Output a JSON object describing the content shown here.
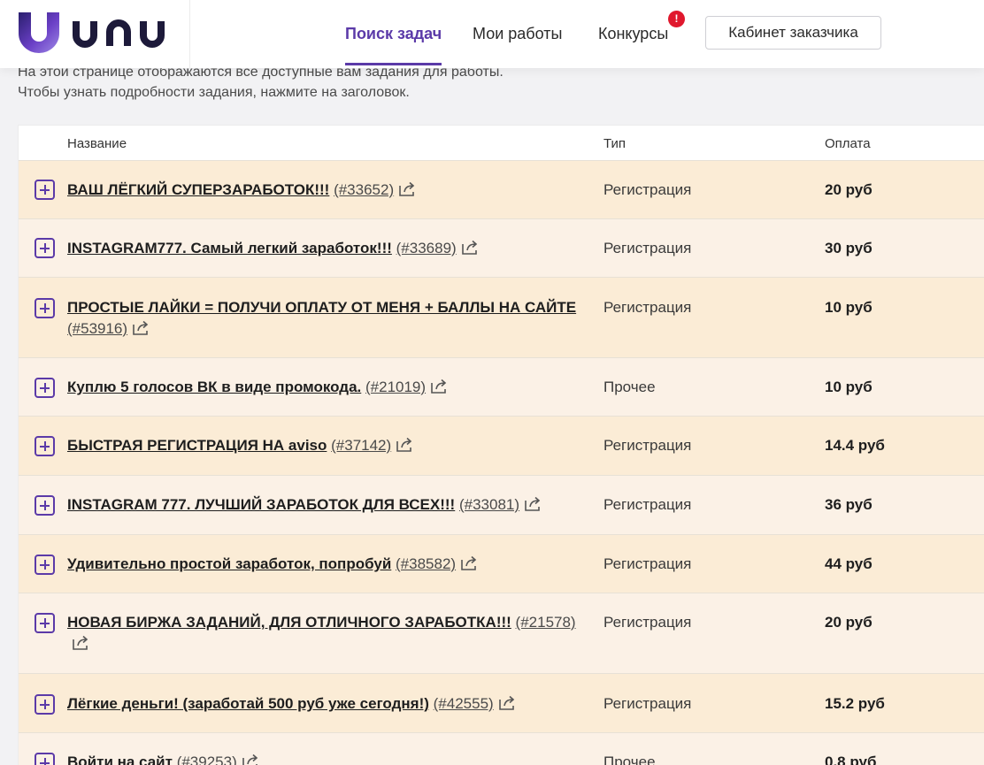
{
  "header": {
    "logo_text": "unu",
    "nav": [
      {
        "label": "Поиск задач"
      },
      {
        "label": "Мои работы"
      },
      {
        "label": "Конкурсы"
      }
    ],
    "badge": "!",
    "cabinet_button": "Кабинет заказчика",
    "colors": {
      "accent": "#5b3aa8",
      "badge": "#e0182d"
    }
  },
  "intro": {
    "line1": "На этой странице отображаются все доступные вам задания для работы.",
    "line2": "Чтобы узнать подробности задания, нажмите на заголовок."
  },
  "table": {
    "columns": {
      "name": "Название",
      "type": "Тип",
      "pay": "Оплата"
    },
    "rows": [
      {
        "title": "ВАШ ЛЁГКИЙ СУПЕРЗАРАБОТОК!!!",
        "id": "(#33652)",
        "type": "Регистрация",
        "pay": "20 руб"
      },
      {
        "title": "INSTAGRAM777. Самый легкий заработок!!!",
        "id": "(#33689)",
        "type": "Регистрация",
        "pay": "30 руб"
      },
      {
        "title": "ПРОСТЫЕ ЛАЙКИ = ПОЛУЧИ ОПЛАТУ ОТ МЕНЯ + БАЛЛЫ НА САЙТЕ",
        "id": "(#53916)",
        "type": "Регистрация",
        "pay": "10 руб"
      },
      {
        "title": "Куплю 5 голосов ВК в виде промокода.",
        "id": "(#21019)",
        "type": "Прочее",
        "pay": "10 руб"
      },
      {
        "title": "БЫСТРАЯ РЕГИСТРАЦИЯ НА aviso",
        "id": "(#37142)",
        "type": "Регистрация",
        "pay": "14.4 руб"
      },
      {
        "title": "INSTAGRAM 777. ЛУЧШИЙ ЗАРАБОТОК ДЛЯ ВСЕХ!!!",
        "id": "(#33081)",
        "type": "Регистрация",
        "pay": "36 руб"
      },
      {
        "title": "Удивительно простой заработок, попробуй",
        "id": "(#38582)",
        "type": "Регистрация",
        "pay": "44 руб"
      },
      {
        "title": "НОВАЯ БИРЖА ЗАДАНИЙ, ДЛЯ ОТЛИЧНОГО ЗАРАБОТКА!!!",
        "id": "(#21578)",
        "type": "Регистрация",
        "pay": "20 руб"
      },
      {
        "title": "Лёгкие деньги! (заработай 500 руб уже сегодня!)",
        "id": "(#42555)",
        "type": "Регистрация",
        "pay": "15.2 руб"
      },
      {
        "title": "Войти на сайт",
        "id": "(#39253)",
        "type": "Прочее",
        "pay": "0.8 руб"
      }
    ]
  }
}
